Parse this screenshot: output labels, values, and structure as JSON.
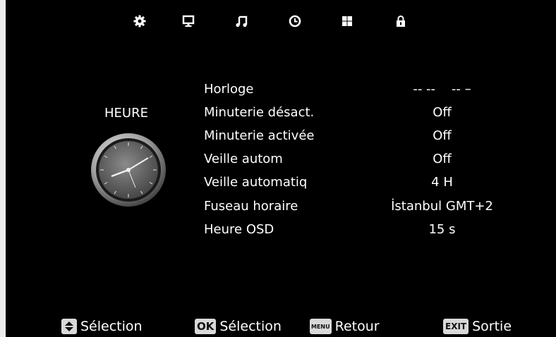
{
  "top_icons": [
    "gear-icon",
    "monitor-icon",
    "music-note-icon",
    "clock-icon",
    "grid-icon",
    "lock-icon"
  ],
  "section": {
    "title": "HEURE"
  },
  "menu": [
    {
      "label": "Horloge",
      "value": "-- --    -- –"
    },
    {
      "label": "Minuterie désact.",
      "value": "Off"
    },
    {
      "label": "Minuterie activée",
      "value": "Off"
    },
    {
      "label": "Veille autom",
      "value": "Off"
    },
    {
      "label": "Veille automatiq",
      "value": "4 H"
    },
    {
      "label": "Fuseau horaire",
      "value": "İstanbul GMT+2"
    },
    {
      "label": "Heure OSD",
      "value": "15 s"
    }
  ],
  "footer": {
    "nav": {
      "icon": "up-down-arrow-icon",
      "label": "Sélection"
    },
    "ok": {
      "key": "OK",
      "label": "Sélection"
    },
    "menu": {
      "key": "MENU",
      "label": "Retour"
    },
    "exit": {
      "key": "EXIT",
      "label": "Sortie"
    }
  },
  "colors": {
    "background": "#000000",
    "text": "#ffffff",
    "key_bg": "#d9d9d9"
  }
}
